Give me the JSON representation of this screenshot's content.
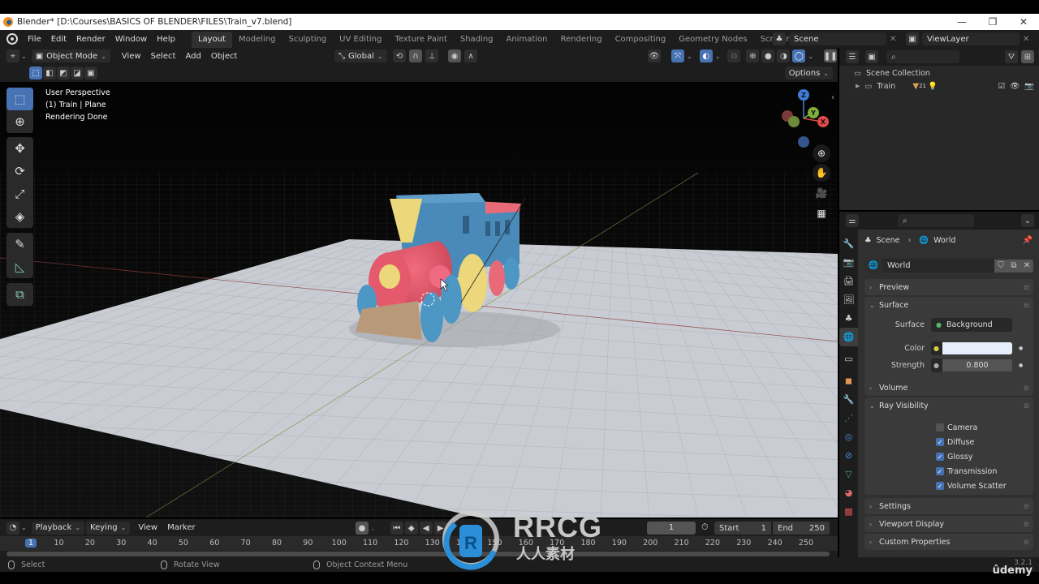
{
  "window": {
    "title": "Blender* [D:\\Courses\\BASICS OF BLENDER\\FILES\\Train_v7.blend]",
    "controls": [
      "—",
      "❐",
      "✕"
    ]
  },
  "menu": [
    "File",
    "Edit",
    "Render",
    "Window",
    "Help"
  ],
  "workspaces": [
    {
      "label": "Layout",
      "active": true
    },
    {
      "label": "Modeling"
    },
    {
      "label": "Sculpting"
    },
    {
      "label": "UV Editing"
    },
    {
      "label": "Texture Paint"
    },
    {
      "label": "Shading"
    },
    {
      "label": "Animation"
    },
    {
      "label": "Rendering"
    },
    {
      "label": "Compositing"
    },
    {
      "label": "Geometry Nodes"
    },
    {
      "label": "Scripting"
    }
  ],
  "add_workspace": "+",
  "scene_selector": {
    "value": "Scene"
  },
  "viewlayer_selector": {
    "value": "ViewLayer"
  },
  "viewport_header": {
    "mode": "Object Mode",
    "menus": [
      "View",
      "Select",
      "Add",
      "Object"
    ],
    "orientation": "Global",
    "options_label": "Options"
  },
  "viewport": {
    "info": [
      "User Perspective",
      "(1) Train | Plane",
      "Rendering Done"
    ],
    "gizmo": {
      "x": "X",
      "y": "Y",
      "z": "Z"
    },
    "object_colors": {
      "boiler": "#e8566a",
      "cab": "#4a8ab8",
      "accent_yellow": "#ecd77a",
      "wheel_blue": "#4d97c4",
      "cowcatcher": "#b89a7a",
      "roof": "#e86a78",
      "floor": "#c9ccd2"
    }
  },
  "toolbar": [
    {
      "name": "select-box",
      "glyph": "⬚",
      "active": true
    },
    {
      "name": "cursor",
      "glyph": "⊕"
    },
    {
      "name": "move",
      "glyph": "✥"
    },
    {
      "name": "rotate",
      "glyph": "⟳"
    },
    {
      "name": "scale",
      "glyph": "⤢"
    },
    {
      "name": "transform",
      "glyph": "◈"
    },
    {
      "name": "annotate",
      "glyph": "✎"
    },
    {
      "name": "measure",
      "glyph": "📐"
    },
    {
      "name": "add-cube",
      "glyph": "⧉"
    }
  ],
  "outliner": {
    "search_placeholder": "",
    "root": "Scene Collection",
    "items": [
      {
        "label": "Train",
        "badge": "21"
      }
    ]
  },
  "properties": {
    "breadcrumb": [
      "Scene",
      "World"
    ],
    "world_name": "World",
    "panels": {
      "preview": "Preview",
      "surface": "Surface",
      "volume": "Volume",
      "ray_visibility": "Ray Visibility",
      "settings": "Settings",
      "viewport_display": "Viewport Display",
      "custom_properties": "Custom Properties"
    },
    "surface": {
      "surface_label": "Surface",
      "surface_value": "Background",
      "color_label": "Color",
      "color_value": "#e6eefc",
      "strength_label": "Strength",
      "strength_value": "0.800"
    },
    "ray_visibility": [
      {
        "label": "Camera",
        "checked": false
      },
      {
        "label": "Diffuse",
        "checked": true
      },
      {
        "label": "Glossy",
        "checked": true
      },
      {
        "label": "Transmission",
        "checked": true
      },
      {
        "label": "Volume Scatter",
        "checked": true
      }
    ],
    "tabs": [
      "tool",
      "render",
      "output",
      "view-layer",
      "scene",
      "world",
      "collection",
      "object",
      "modifiers",
      "particles",
      "physics",
      "constraints",
      "data",
      "material",
      "texture"
    ]
  },
  "timeline": {
    "menus": [
      "Playback",
      "Keying",
      "View",
      "Marker"
    ],
    "current_frame": "1",
    "start_label": "Start",
    "start": "1",
    "end_label": "End",
    "end": "250",
    "ticks": [
      "1",
      "10",
      "20",
      "30",
      "40",
      "50",
      "60",
      "70",
      "80",
      "90",
      "100",
      "110",
      "120",
      "130",
      "140",
      "150",
      "160",
      "170",
      "180",
      "190",
      "200",
      "210",
      "220",
      "230",
      "240",
      "250"
    ]
  },
  "statusbar": {
    "select": "Select",
    "rotate": "Rotate View",
    "context": "Object Context Menu",
    "version": "3.2.1"
  },
  "watermark": {
    "brand": "RRCG",
    "sub": "人人素材",
    "udemy": "ûdemy"
  },
  "colors": {
    "accent": "#4772b3",
    "bg_dark": "#1d1d1d",
    "panel": "#303030"
  }
}
